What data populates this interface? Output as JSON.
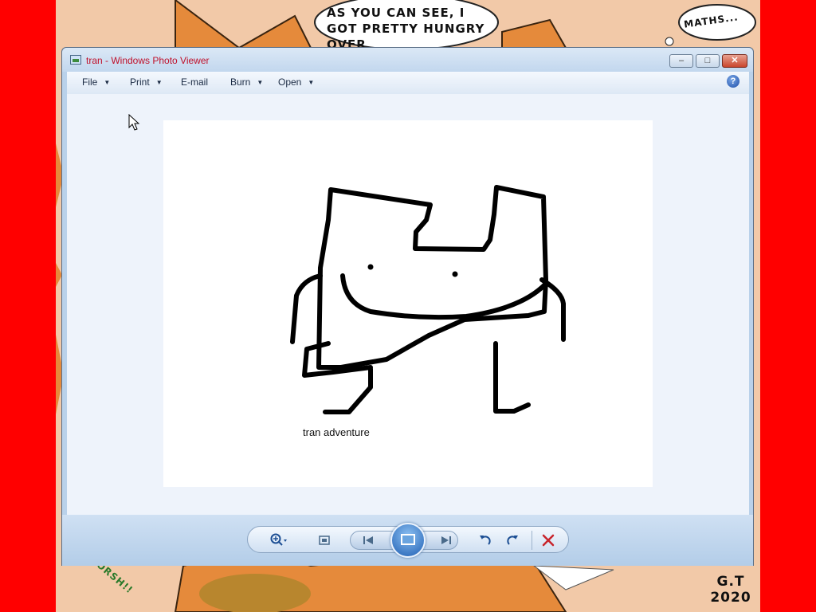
{
  "desktop": {
    "comic_speech_text": "AS YOU CAN SEE, I GOT PRETTY HUNGRY OVER",
    "comic_thought_text": "MATHS...",
    "comic_signature": "G.T 2020",
    "comic_sfx": "GHLORSH!!"
  },
  "window": {
    "title": "tran - Windows Photo Viewer",
    "controls": {
      "minimize": "–",
      "maximize": "□",
      "close": "✕"
    }
  },
  "menubar": {
    "file": "File",
    "print": "Print",
    "email": "E-mail",
    "burn": "Burn",
    "open": "Open",
    "dropdown_arrow": "▼",
    "help": "?"
  },
  "image": {
    "caption": "tran adventure"
  },
  "toolbar": {
    "icons": [
      "zoom-icon",
      "fit-to-window-icon",
      "previous-icon",
      "slideshow-icon",
      "next-icon",
      "rotate-counterclockwise-icon",
      "rotate-clockwise-icon",
      "delete-icon"
    ]
  },
  "colors": {
    "desktop_red": "#ff0000",
    "title_text": "#c0102a",
    "accent_blue": "#1f5fb3",
    "delete_red": "#c8252c"
  }
}
